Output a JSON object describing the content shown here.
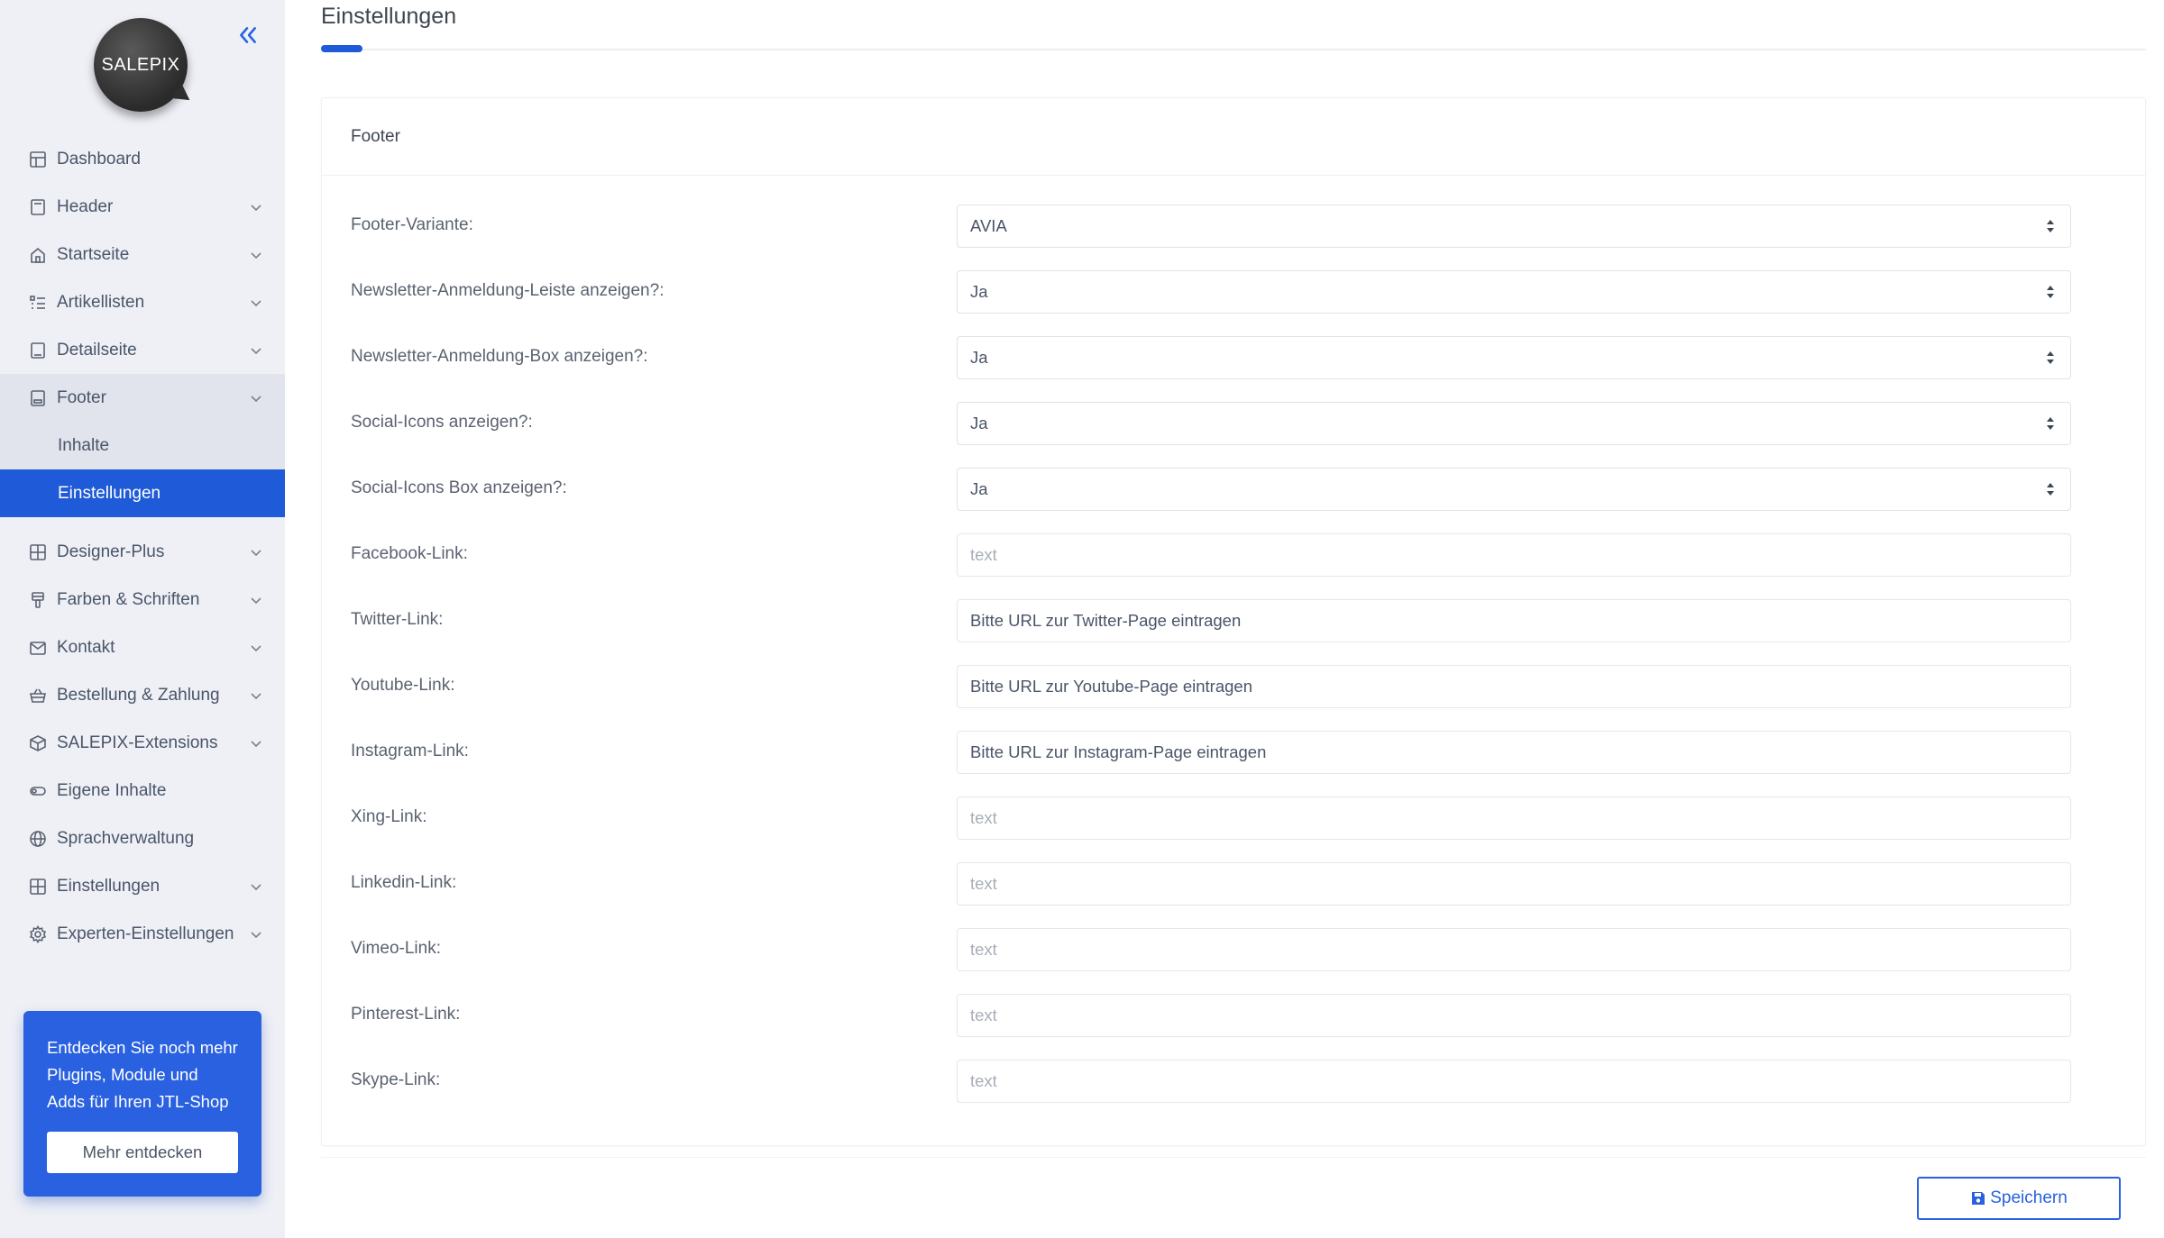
{
  "sidebar": {
    "logo_text": "SALEPIX",
    "items": [
      {
        "label": "Dashboard",
        "icon": "dashboard-icon",
        "has_children": false
      },
      {
        "label": "Header",
        "icon": "header-icon",
        "has_children": true
      },
      {
        "label": "Startseite",
        "icon": "home-icon",
        "has_children": true
      },
      {
        "label": "Artikellisten",
        "icon": "list-icon",
        "has_children": true
      },
      {
        "label": "Detailseite",
        "icon": "page-icon",
        "has_children": true
      },
      {
        "label": "Footer",
        "icon": "footer-icon",
        "has_children": true,
        "open": true
      },
      {
        "label": "Designer-Plus",
        "icon": "grid-icon",
        "has_children": true
      },
      {
        "label": "Farben & Schriften",
        "icon": "brush-icon",
        "has_children": true
      },
      {
        "label": "Kontakt",
        "icon": "mail-icon",
        "has_children": true
      },
      {
        "label": "Bestellung & Zahlung",
        "icon": "basket-icon",
        "has_children": true
      },
      {
        "label": "SALEPIX-Extensions",
        "icon": "package-icon",
        "has_children": true
      },
      {
        "label": "Eigene Inhalte",
        "icon": "toggle-icon",
        "has_children": false
      },
      {
        "label": "Sprachverwaltung",
        "icon": "globe-icon",
        "has_children": false
      },
      {
        "label": "Einstellungen",
        "icon": "grid-icon",
        "has_children": true
      },
      {
        "label": "Experten-Einstellungen",
        "icon": "gear-icon",
        "has_children": true
      }
    ],
    "footer_sub": [
      {
        "label": "Inhalte",
        "active": false
      },
      {
        "label": "Einstellungen",
        "active": true
      }
    ],
    "promo": {
      "text": "Entdecken Sie noch mehr Plugins, Module und Adds für Ihren JTL-Shop",
      "button": "Mehr entdecken"
    }
  },
  "main": {
    "page_title": "Einstellungen",
    "card_title": "Footer",
    "selects": [
      {
        "label": "Footer-Variante:",
        "value": "AVIA"
      },
      {
        "label": "Newsletter-Anmeldung-Leiste anzeigen?:",
        "value": "Ja"
      },
      {
        "label": "Newsletter-Anmeldung-Box anzeigen?:",
        "value": "Ja"
      },
      {
        "label": "Social-Icons anzeigen?:",
        "value": "Ja"
      },
      {
        "label": "Social-Icons Box anzeigen?:",
        "value": "Ja"
      }
    ],
    "inputs": [
      {
        "label": "Facebook-Link:",
        "value": "",
        "placeholder": "text"
      },
      {
        "label": "Twitter-Link:",
        "value": "Bitte URL zur Twitter-Page eintragen",
        "placeholder": "text"
      },
      {
        "label": "Youtube-Link:",
        "value": "Bitte URL zur Youtube-Page eintragen",
        "placeholder": "text"
      },
      {
        "label": "Instagram-Link:",
        "value": "Bitte URL zur Instagram-Page eintragen",
        "placeholder": "text"
      },
      {
        "label": "Xing-Link:",
        "value": "",
        "placeholder": "text"
      },
      {
        "label": "Linkedin-Link:",
        "value": "",
        "placeholder": "text"
      },
      {
        "label": "Vimeo-Link:",
        "value": "",
        "placeholder": "text"
      },
      {
        "label": "Pinterest-Link:",
        "value": "",
        "placeholder": "text"
      },
      {
        "label": "Skype-Link:",
        "value": "",
        "placeholder": "text"
      }
    ],
    "save_label": "Speichern"
  },
  "colors": {
    "accent": "#1f5ad8",
    "sidebar_bg": "#eef0f6",
    "promo_bg": "#2961e0"
  }
}
